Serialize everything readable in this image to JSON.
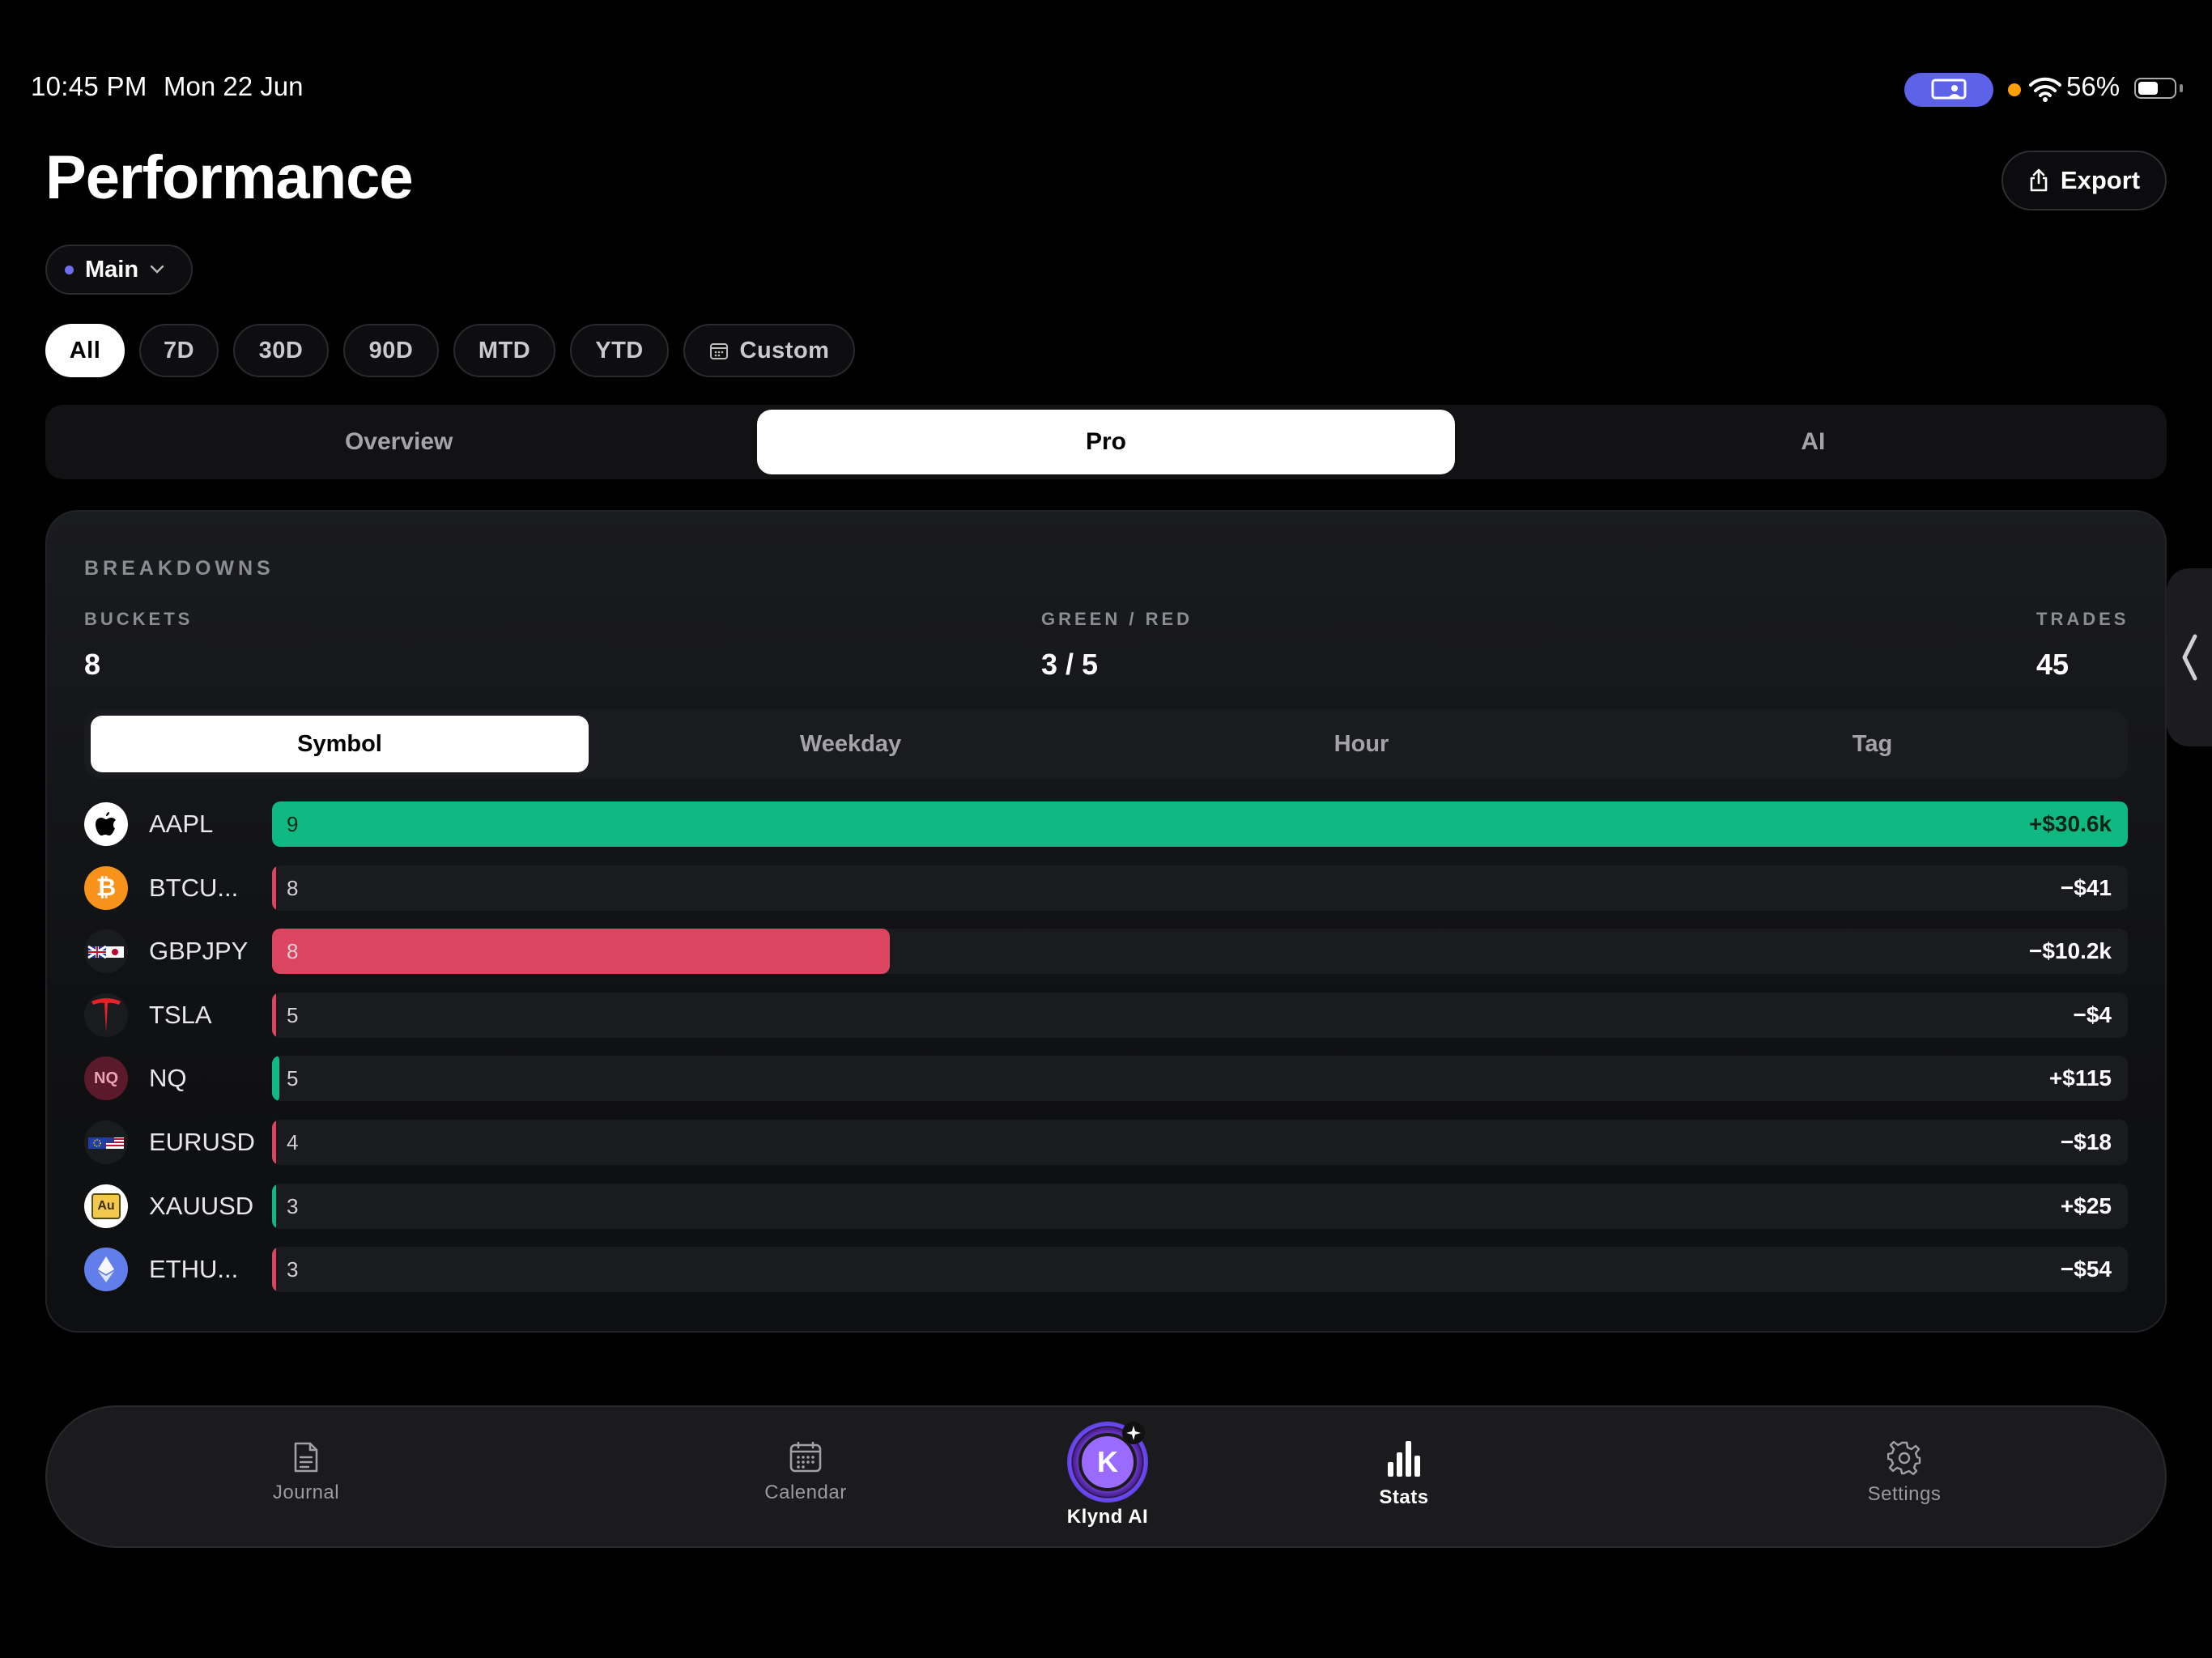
{
  "status": {
    "time": "10:45 PM",
    "date": "Mon 22 Jun",
    "battery_pct": "56%",
    "battery_level": 0.56
  },
  "header": {
    "title": "Performance",
    "export_label": "Export"
  },
  "account": {
    "label": "Main"
  },
  "ranges": [
    {
      "label": "All",
      "active": true
    },
    {
      "label": "7D"
    },
    {
      "label": "30D"
    },
    {
      "label": "90D"
    },
    {
      "label": "MTD"
    },
    {
      "label": "YTD"
    },
    {
      "label": "Custom",
      "icon": "calendar-icon"
    }
  ],
  "main_tabs": [
    {
      "label": "Overview"
    },
    {
      "label": "Pro",
      "active": true
    },
    {
      "label": "AI"
    }
  ],
  "breakdowns": {
    "title": "BREAKDOWNS",
    "stats": {
      "buckets_label": "BUCKETS",
      "buckets_value": "8",
      "greenred_label": "GREEN / RED",
      "greenred_value": "3 / 5",
      "trades_label": "TRADES",
      "trades_value": "45"
    },
    "tabs": [
      {
        "label": "Symbol",
        "active": true
      },
      {
        "label": "Weekday"
      },
      {
        "label": "Hour"
      },
      {
        "label": "Tag"
      }
    ],
    "rows": [
      {
        "symbol": "AAPL",
        "count": "9",
        "pnl": "+$30.6k",
        "fill": 1.0,
        "positive": true,
        "icon": "apple-icon"
      },
      {
        "symbol": "BTCU...",
        "count": "8",
        "pnl": "−$41",
        "fill": 0.0013,
        "positive": false,
        "icon": "bitcoin-icon"
      },
      {
        "symbol": "GBPJPY",
        "count": "8",
        "pnl": "−$10.2k",
        "fill": 0.333,
        "positive": false,
        "icon": "gbpjpy-flag-icon"
      },
      {
        "symbol": "TSLA",
        "count": "5",
        "pnl": "−$4",
        "fill": 0.0001,
        "positive": false,
        "icon": "tesla-icon"
      },
      {
        "symbol": "NQ",
        "count": "5",
        "pnl": "+$115",
        "fill": 0.0038,
        "positive": true,
        "icon": "nq-icon",
        "icon_text": "NQ"
      },
      {
        "symbol": "EURUSD",
        "count": "4",
        "pnl": "−$18",
        "fill": 0.0006,
        "positive": false,
        "icon": "eurusd-flag-icon"
      },
      {
        "symbol": "XAUUSD",
        "count": "3",
        "pnl": "+$25",
        "fill": 0.0008,
        "positive": true,
        "icon": "gold-icon",
        "icon_text": "Au"
      },
      {
        "symbol": "ETHU...",
        "count": "3",
        "pnl": "−$54",
        "fill": 0.0018,
        "positive": false,
        "icon": "ethereum-icon"
      }
    ]
  },
  "tabbar": [
    {
      "label": "Journal",
      "icon": "document-icon"
    },
    {
      "label": "Calendar",
      "icon": "calendar-icon"
    },
    {
      "label": "Klynd AI",
      "icon": "klynd-ai-icon",
      "active": true,
      "icon_text": "K"
    },
    {
      "label": "Stats",
      "icon": "bar-chart-icon",
      "active": true
    },
    {
      "label": "Settings",
      "icon": "gear-icon"
    }
  ],
  "colors": {
    "positive": "#10b981",
    "negative": "#dc4560",
    "accent": "#6b6ff0"
  }
}
